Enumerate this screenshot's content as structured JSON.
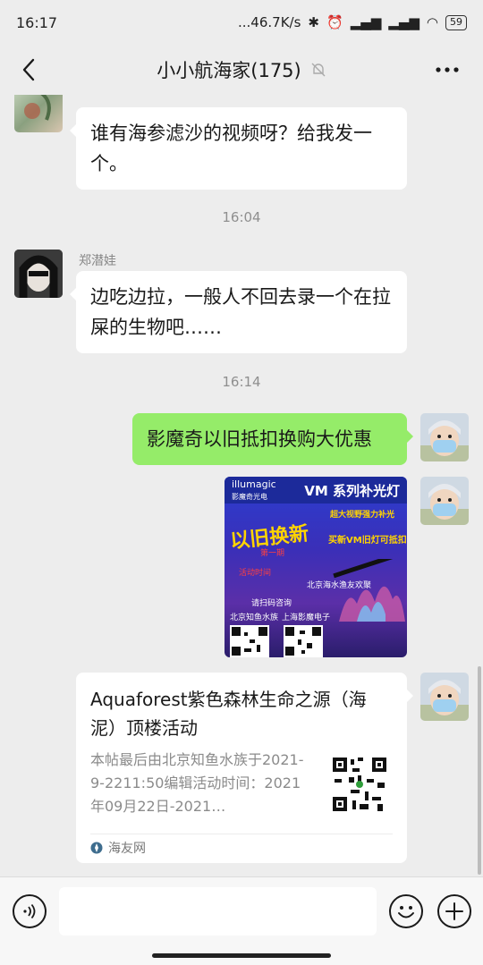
{
  "status_bar": {
    "time": "16:17",
    "network_speed": "...46.7K/s",
    "battery": "59"
  },
  "header": {
    "title": "小小航海家(175)",
    "mute_icon": "bell-off-icon",
    "more_icon": "more-dots-icon"
  },
  "messages": [
    {
      "side": "left",
      "text": "谁有海参滤沙的视频呀？给我发一个。"
    },
    {
      "type": "time",
      "text": "16:04"
    },
    {
      "side": "left",
      "sender": "郑潜娃",
      "text": "边吃边拉，一般人不回去录一个在拉屎的生物吧……"
    },
    {
      "type": "time",
      "text": "16:14"
    },
    {
      "side": "right",
      "text": "影魔奇以旧抵扣换购大优惠"
    },
    {
      "side": "right",
      "type": "image",
      "poster": {
        "brand": "illumagic",
        "brand_sub": "影魔奇光电",
        "title": "VM 系列补光灯",
        "tag_top": "超大视野强力补光",
        "exchange": "以旧换新",
        "round": "第一期",
        "offer": "买新VM旧灯可抵扣",
        "activity": "活动时间",
        "venue": "北京海水渔友欢聚",
        "contact": "请扫码咨询",
        "shop_a": "北京知鱼水族",
        "shop_b": "上海影魔电子"
      }
    },
    {
      "side": "right",
      "type": "card",
      "title": "Aquaforest紫色森林生命之源（海泥）顶楼活动",
      "desc": "本帖最后由北京知鱼水族于2021-9-2211:50编辑活动时间：2021年09月22日-2021…",
      "source": "海友网"
    }
  ],
  "input_bar": {
    "voice_icon": "voice-icon",
    "emoji_icon": "emoji-icon",
    "plus_icon": "plus-icon",
    "placeholder": ""
  }
}
